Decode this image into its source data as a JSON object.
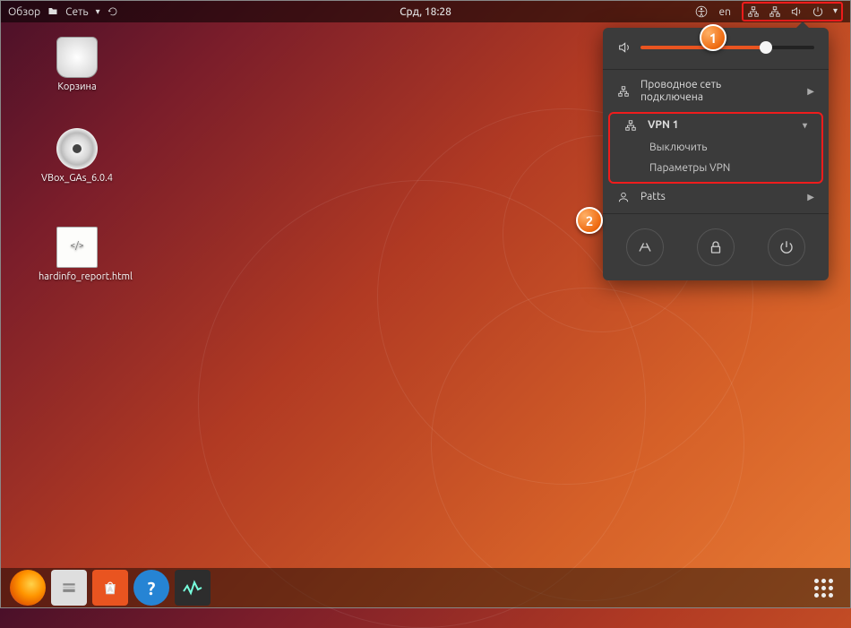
{
  "topbar": {
    "activities": "Обзор",
    "places": "Сеть",
    "clock": "Срд, 18:28",
    "locale": "en"
  },
  "desktop_icons": {
    "trash": "Корзина",
    "disc": "VBox_GAs_6.0.4",
    "file": "hardinfo_report.html"
  },
  "system_menu": {
    "wired": {
      "line1": "Проводное сеть",
      "line2": "подключена"
    },
    "vpn": {
      "title": "VPN 1",
      "turn_off": "Выключить",
      "settings": "Параметры VPN"
    },
    "user": "Patts"
  },
  "annotations": {
    "a1": "1",
    "a2": "2"
  },
  "colors": {
    "accent": "#e95420",
    "highlight": "#ef1c1c"
  }
}
